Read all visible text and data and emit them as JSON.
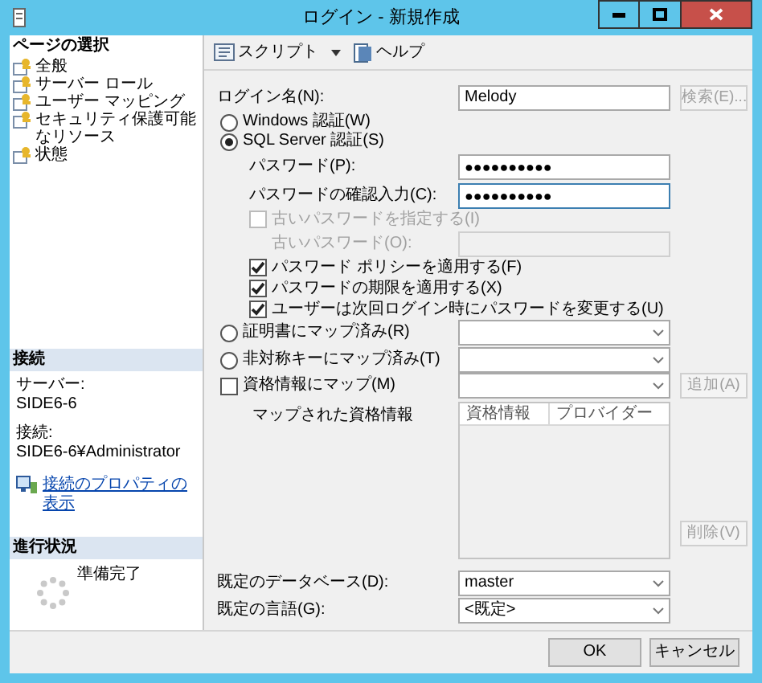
{
  "window": {
    "title": "ログイン - 新規作成"
  },
  "sidebar": {
    "heading": "ページの選択",
    "pages": [
      {
        "label": "全般"
      },
      {
        "label": "サーバー ロール"
      },
      {
        "label": "ユーザー マッピング"
      },
      {
        "label": "セキュリティ保護可能なリソース"
      },
      {
        "label": "状態"
      }
    ]
  },
  "connection": {
    "heading": "接続",
    "items": [
      {
        "label": "サーバー:",
        "value": "SIDE6-6"
      },
      {
        "label": "接続:",
        "value": "SIDE6-6¥Administrator"
      }
    ],
    "link": "接続のプロパティの表示"
  },
  "progress": {
    "heading": "進行状況",
    "status": "準備完了"
  },
  "toolbar": [
    {
      "label": "スクリプト",
      "has_menu": true
    },
    {
      "label": "ヘルプ",
      "has_menu": false
    }
  ],
  "login_name": {
    "label": "ログイン名(N):",
    "value": "Melody",
    "button": {
      "label": "検索(E)...",
      "disabled": true
    }
  },
  "auth": [
    {
      "label": "Windows 認証(W)",
      "selected": false
    },
    {
      "label": "SQL Server 認証(S)",
      "selected": true
    }
  ],
  "passwords": [
    {
      "label": "パスワード(P):",
      "value": "●●●●●●●●●●",
      "focused": false
    },
    {
      "label": "パスワードの確認入力(C):",
      "value": "●●●●●●●●●●",
      "focused": true
    }
  ],
  "old_password": {
    "check_label": "古いパスワードを指定する(I)",
    "checked": false,
    "disabled": true,
    "label": "古いパスワード(O):"
  },
  "policies": [
    {
      "label": "パスワード ポリシーを適用する(F)",
      "checked": true
    },
    {
      "label": "パスワードの期限を適用する(X)",
      "checked": true
    },
    {
      "label": "ユーザーは次回ログイン時にパスワードを変更する(U)",
      "checked": true
    }
  ],
  "mappings": [
    {
      "kind": "radio",
      "label": "証明書にマップ済み(R)",
      "selected": false
    },
    {
      "kind": "radio",
      "label": "非対称キーにマップ済み(T)",
      "selected": false
    },
    {
      "kind": "checkbox",
      "label": "資格情報にマップ(M)",
      "checked": false,
      "button": {
        "label": "追加(A)",
        "disabled": true
      }
    }
  ],
  "mapped_credentials": {
    "label": "マップされた資格情報",
    "columns": [
      "資格情報",
      "プロバイダー"
    ],
    "button": {
      "label": "削除(V)",
      "disabled": true
    }
  },
  "defaults": [
    {
      "label": "既定のデータベース(D):",
      "value": "master"
    },
    {
      "label": "既定の言語(G):",
      "value": "<既定>"
    }
  ],
  "buttons": [
    {
      "label": "OK"
    },
    {
      "label": "キャンセル"
    }
  ]
}
